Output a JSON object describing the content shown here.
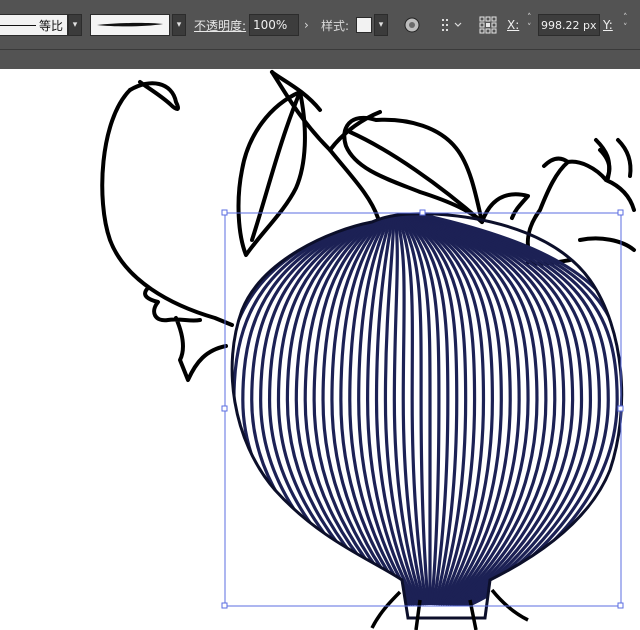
{
  "control_bar": {
    "stroke_profile_label": "等比",
    "opacity_label": "不透明度:",
    "opacity_value": "100%",
    "style_label": "样式:",
    "x_label": "X:",
    "x_value": "998.22 px",
    "y_label": "Y:"
  },
  "icons": {
    "profile_dropdown": "chevron-down-icon",
    "brush_dropdown": "chevron-down-icon",
    "opacity_arrow": "chevron-right-icon",
    "style_dropdown": "chevron-down-icon",
    "recolor": "recolor-artwork-icon",
    "align": "align-to-icon",
    "reference_point": "reference-point-icon",
    "stepper": "stepper-icon"
  },
  "colors": {
    "toolbar_bg": "#535353",
    "selection": "#5b6ee1",
    "stripe_fill": "#1c2155",
    "artwork_stroke": "#000000"
  }
}
